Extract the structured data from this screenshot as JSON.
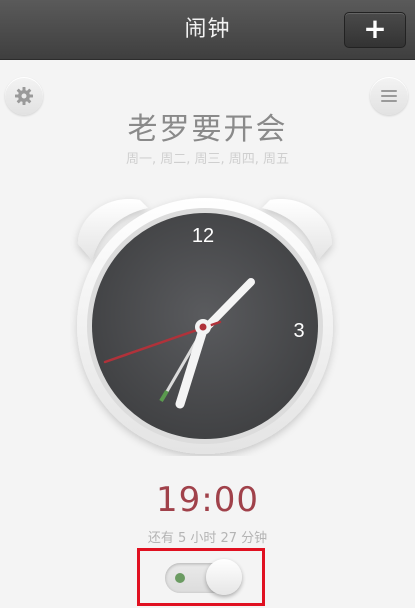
{
  "header": {
    "title": "闹钟",
    "add_label": "+"
  },
  "alarm": {
    "name": "老罗要开会",
    "days": "周一, 周二, 周三, 周四, 周五",
    "time": "19:00",
    "remaining": "还有 5 小时 27 分钟",
    "enabled": true
  },
  "clock": {
    "numeral_12": "12",
    "numeral_3": "3",
    "display_time": "14:33",
    "face_color": "#4f5052",
    "second_hand_color": "#b0323a",
    "alarm_hand_color": "#5a9a4e"
  },
  "icons": {
    "settings": "gear-icon",
    "menu": "menu-icon",
    "add": "plus-icon"
  }
}
